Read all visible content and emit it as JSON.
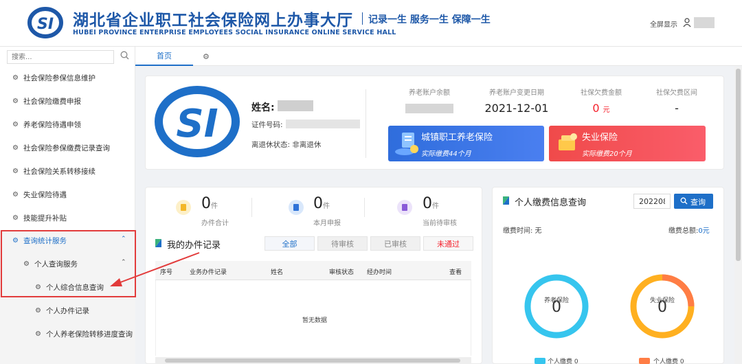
{
  "header": {
    "title": "湖北省企业职工社会保险网上办事大厅",
    "slogan": "记录一生 服务一生 保障一生",
    "subtitle_en": "HUBEI PROVINCE ENTERPRISE EMPLOYEES SOCIAL INSURANCE ONLINE SERVICE HALL",
    "fullscreen_label": "全屏显示",
    "logo_text": "SI",
    "brand_color": "#1e58a8"
  },
  "sidebar": {
    "search_placeholder": "搜索...",
    "items": [
      {
        "label": "社会保险参保信息维护"
      },
      {
        "label": "社会保险缴费申报"
      },
      {
        "label": "养老保险待遇申领"
      },
      {
        "label": "社会保险参保缴费记录查询"
      },
      {
        "label": "社会保险关系转移接续"
      },
      {
        "label": "失业保险待遇"
      },
      {
        "label": "技能提升补贴"
      },
      {
        "label": "查询统计服务"
      },
      {
        "label": "个人查询服务"
      },
      {
        "label": "个人综合信息查询"
      },
      {
        "label": "个人办件记录"
      },
      {
        "label": "个人养老保险转移进度查询"
      }
    ]
  },
  "tabs": {
    "home": "首页"
  },
  "profile": {
    "name_label": "姓名:",
    "id_label": "证件号码:",
    "retire_label": "离退休状态: 非离退休"
  },
  "stats": {
    "pension_balance_label": "养老账户余额",
    "pension_change_date_label": "养老账户变更日期",
    "pension_change_date": "2021-12-01",
    "arrears_amount_label": "社保欠费金额",
    "arrears_amount": "0",
    "arrears_unit": "元",
    "arrears_period_label": "社保欠费区间",
    "arrears_period": "-"
  },
  "insurance": {
    "pension_title": "城镇职工养老保险",
    "pension_paid": "实际缴费44个月",
    "unemployment_title": "失业保险",
    "unemployment_paid": "实际缴费20个月",
    "pension_color": "#2f6ddc",
    "unemployment_color": "#f04a4a"
  },
  "counts": {
    "unit": "件",
    "total_value": "0",
    "total_label": "办件合计",
    "month_value": "0",
    "month_label": "本月申报",
    "pending_value": "0",
    "pending_label": "当前待审核"
  },
  "records": {
    "title": "我的办件记录",
    "filters": {
      "all": "全部",
      "pending": "待审核",
      "approved": "已审核",
      "rejected": "未通过"
    },
    "columns": {
      "seq": "序号",
      "business": "业务办件记录",
      "name": "姓名",
      "status": "审核状态",
      "time": "经办时间",
      "view": "查看"
    },
    "empty": "暂无数据"
  },
  "payment": {
    "title": "个人缴费信息查询",
    "period_value": "202208",
    "query_label": "查询",
    "time_label": "缴费时间: 无",
    "total_label": "缴费总额:",
    "total_value": "0元"
  },
  "donuts": {
    "pension_label": "养老保险",
    "pension_value": "0",
    "pension_legend": "个人缴费 0",
    "pension_color": "#36c5ee",
    "unemployment_label": "失业保险",
    "unemployment_value": "0",
    "unemployment_legend": "个人缴费 0",
    "unemployment_color": "#ff7d45"
  }
}
